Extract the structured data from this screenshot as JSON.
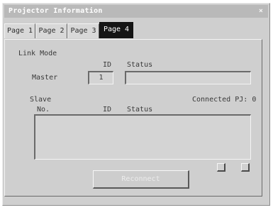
{
  "window": {
    "title": "Projector Information",
    "close_glyph": "×"
  },
  "tabs": [
    {
      "label": "Page 1",
      "active": false
    },
    {
      "label": "Page 2",
      "active": false
    },
    {
      "label": "Page 3",
      "active": false
    },
    {
      "label": "Page 4",
      "active": true
    }
  ],
  "link_mode": {
    "heading": "Link Mode",
    "id_header": "ID",
    "status_header": "Status",
    "master_label": "Master",
    "master_id": "1",
    "master_status": ""
  },
  "slave": {
    "heading": "Slave",
    "no_header": "No.",
    "id_header": "ID",
    "status_header": "Status",
    "connected_label": "Connected PJ:",
    "connected_count": "0",
    "rows": []
  },
  "buttons": {
    "reconnect": "Reconnect"
  },
  "icons": {
    "scroll_left": "scroll-left-icon",
    "scroll_right": "scroll-right-icon"
  }
}
